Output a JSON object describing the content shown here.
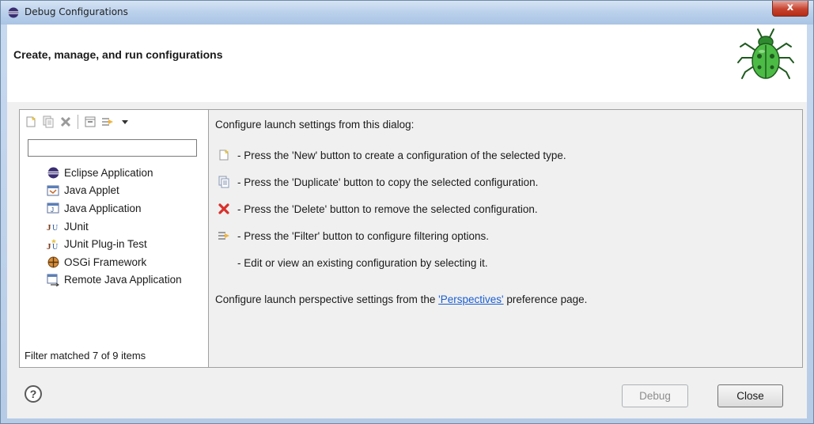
{
  "window": {
    "title": "Debug Configurations",
    "close_glyph": "x"
  },
  "header": {
    "heading": "Create, manage, and run configurations",
    "logo_icon": "bug-icon"
  },
  "left_panel": {
    "toolbar": [
      {
        "name": "new-config-button",
        "icon": "new-icon"
      },
      {
        "name": "duplicate-config-button",
        "icon": "duplicate-icon"
      },
      {
        "name": "delete-config-button",
        "icon": "delete-icon"
      },
      {
        "name": "collapse-all-button",
        "icon": "collapse-icon"
      },
      {
        "name": "filter-config-button",
        "icon": "filter-icon"
      },
      {
        "name": "view-menu-button",
        "icon": "dropdown-arrow-icon"
      }
    ],
    "filter_value": "",
    "tree_items": [
      {
        "label": "Eclipse Application",
        "icon": "eclipse-app-icon"
      },
      {
        "label": "Java Applet",
        "icon": "java-applet-icon"
      },
      {
        "label": "Java Application",
        "icon": "java-application-icon"
      },
      {
        "label": "JUnit",
        "icon": "junit-icon"
      },
      {
        "label": "JUnit Plug-in Test",
        "icon": "junit-plugin-icon"
      },
      {
        "label": "OSGi Framework",
        "icon": "osgi-icon"
      },
      {
        "label": "Remote Java Application",
        "icon": "remote-java-icon"
      }
    ],
    "filter_status": "Filter matched 7 of 9 items"
  },
  "right_panel": {
    "intro": "Configure launch settings from this dialog:",
    "lines": [
      {
        "icon": "new-icon",
        "text": "- Press the 'New' button to create a configuration of the selected type."
      },
      {
        "icon": "duplicate-icon",
        "text": "- Press the 'Duplicate' button to copy the selected configuration."
      },
      {
        "icon": "delete-icon",
        "text": "- Press the 'Delete' button to remove the selected configuration."
      },
      {
        "icon": "filter-icon",
        "text": "- Press the 'Filter' button to configure filtering options."
      },
      {
        "icon": "",
        "text": "- Edit or view an existing configuration by selecting it."
      }
    ],
    "perspective_prefix": "Configure launch perspective settings from the ",
    "perspective_link": "'Perspectives'",
    "perspective_suffix": " preference page."
  },
  "footer": {
    "help_glyph": "?",
    "debug_label": "Debug",
    "close_label": "Close"
  },
  "colors": {
    "link": "#1a5fd1",
    "close_button": "#c7432f",
    "bug_green": "#3fae3f"
  }
}
